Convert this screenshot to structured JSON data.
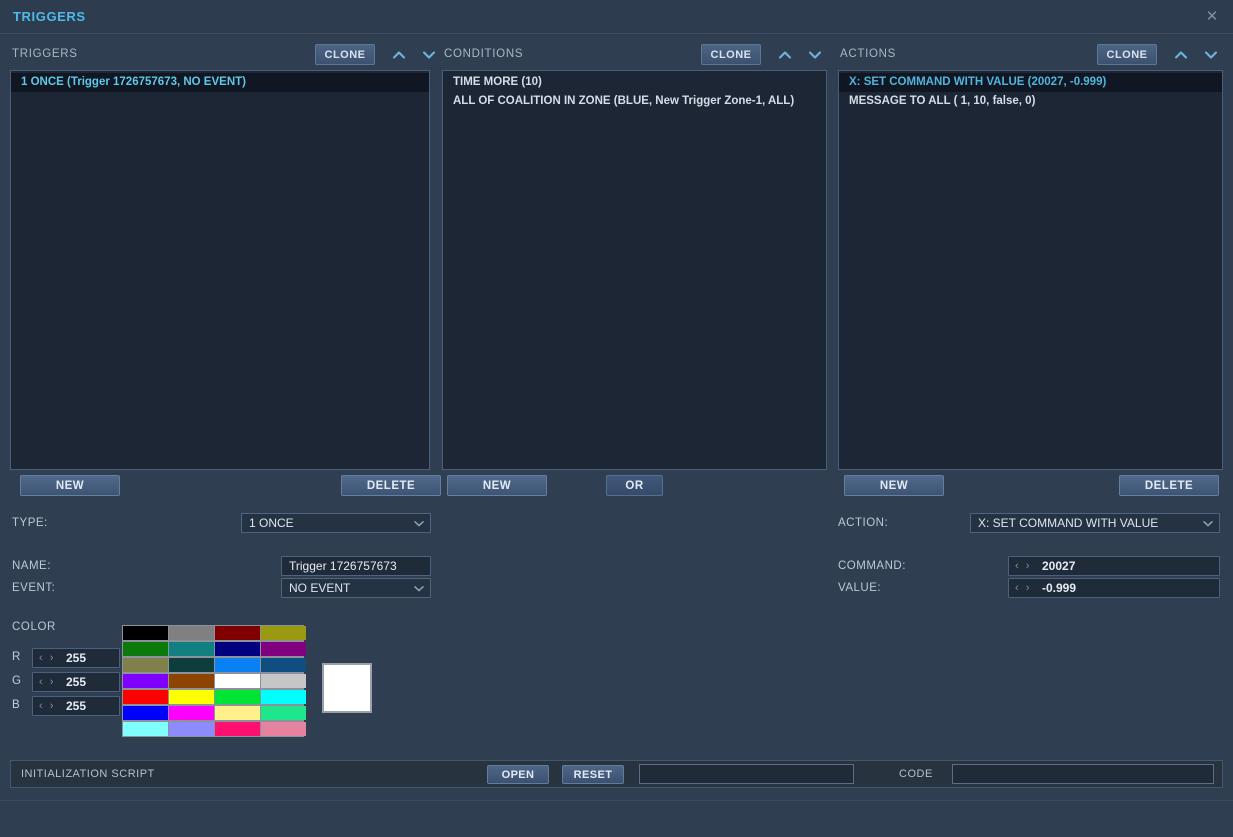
{
  "window": {
    "title": "TRIGGERS",
    "close_icon": "close-icon"
  },
  "panels": {
    "triggers": {
      "header": "TRIGGERS",
      "clone_label": "CLONE",
      "up_icon": "chevron-up-icon",
      "down_icon": "chevron-down-icon",
      "items": [
        {
          "text": "1 ONCE (Trigger 1726757673, NO EVENT)",
          "selected": true
        }
      ],
      "new_label": "NEW",
      "delete_label": "DELETE"
    },
    "conditions": {
      "header": "CONDITIONS",
      "clone_label": "CLONE",
      "up_icon": "chevron-up-icon",
      "down_icon": "chevron-down-icon",
      "items": [
        {
          "text": "TIME MORE (10)",
          "selected": false
        },
        {
          "text": "ALL OF COALITION IN ZONE (BLUE, New Trigger Zone-1, ALL)",
          "selected": false
        }
      ],
      "new_label": "NEW",
      "or_label": "OR"
    },
    "actions": {
      "header": "ACTIONS",
      "clone_label": "CLONE",
      "up_icon": "chevron-up-icon",
      "down_icon": "chevron-down-icon",
      "items": [
        {
          "text": "X: SET COMMAND WITH VALUE (20027, -0.999)",
          "selected": true
        },
        {
          "text": "MESSAGE TO ALL (    1, 10, false, 0)",
          "selected": false
        }
      ],
      "new_label": "NEW",
      "delete_label": "DELETE"
    }
  },
  "trigger_form": {
    "type_label": "TYPE:",
    "type_value": "1 ONCE",
    "name_label": "NAME:",
    "name_value": "Trigger 1726757673",
    "event_label": "EVENT:",
    "event_value": "NO EVENT"
  },
  "action_form": {
    "action_label": "ACTION:",
    "action_value": "X: SET COMMAND WITH VALUE",
    "command_label": "COMMAND:",
    "command_value": "20027",
    "value_label": "VALUE:",
    "value_value": "-0.999",
    "spin_arrows": "‹ ›"
  },
  "color": {
    "section_label": "COLOR",
    "r_label": "R",
    "r_value": "255",
    "g_label": "G",
    "g_value": "255",
    "b_label": "B",
    "b_value": "255",
    "spin_arrows": "‹ ›",
    "preview_hex": "#ffffff",
    "palette": [
      "#000000",
      "#808080",
      "#800000",
      "#9a9a12",
      "#0b7a0b",
      "#128080",
      "#000080",
      "#800080",
      "#80804d",
      "#0d3d3d",
      "#0a80f5",
      "#104d80",
      "#8000ff",
      "#8c4400",
      "#ffffff",
      "#c6c6c6",
      "#ff0000",
      "#ffff00",
      "#00e533",
      "#00ffff",
      "#0000ff",
      "#ff00ff",
      "#fff089",
      "#1fe58c",
      "#80ffff",
      "#8c8cff",
      "#ff0f70",
      "#e582a0"
    ]
  },
  "footer": {
    "init_script_label": "INITIALIZATION SCRIPT",
    "open_label": "OPEN",
    "reset_label": "RESET",
    "script_path_value": "",
    "code_label": "CODE",
    "code_value": ""
  }
}
